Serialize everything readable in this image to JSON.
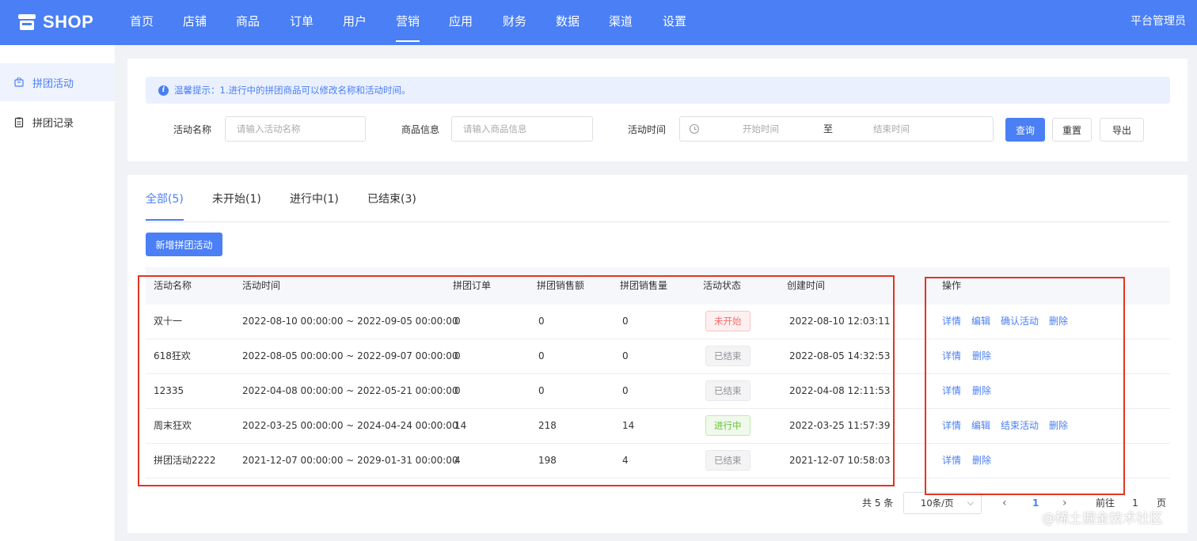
{
  "brand": {
    "logo_text": "SHOP",
    "icon": "shop-store-icon"
  },
  "nav": {
    "items": [
      "首页",
      "店铺",
      "商品",
      "订单",
      "用户",
      "营销",
      "应用",
      "财务",
      "数据",
      "渠道",
      "设置"
    ],
    "active": "营销",
    "admin": "平台管理员"
  },
  "sidebar": {
    "items": [
      {
        "label": "拼团活动",
        "icon": "bag-icon",
        "active": true
      },
      {
        "label": "拼团记录",
        "icon": "clipboard-icon",
        "active": false
      }
    ]
  },
  "filter": {
    "tip": "温馨提示：1.进行中的拼团商品可以修改名称和活动时间。",
    "name_label": "活动名称",
    "name_placeholder": "请输入活动名称",
    "goods_label": "商品信息",
    "goods_placeholder": "请输入商品信息",
    "time_label": "活动时间",
    "start_placeholder": "开始时间",
    "range_sep": "至",
    "end_placeholder": "结束时间",
    "query": "查询",
    "reset": "重置",
    "export": "导出"
  },
  "tabs": [
    "全部(5)",
    "未开始(1)",
    "进行中(1)",
    "已结束(3)"
  ],
  "add_button": "新增拼团活动",
  "table": {
    "headers": [
      "活动名称",
      "活动时间",
      "拼团订单",
      "拼团销售额",
      "拼团销售量",
      "活动状态",
      "创建时间",
      "操作"
    ],
    "rows": [
      {
        "name": "双十一",
        "time": "2022-08-10 00:00:00 ~ 2022-09-05 00:00:00",
        "orders": "0",
        "sales": "0",
        "quantity": "0",
        "status": "未开始",
        "status_type": "pending",
        "created": "2022-08-10 12:03:11",
        "actions": [
          "详情",
          "编辑",
          "确认活动",
          "删除"
        ]
      },
      {
        "name": "618狂欢",
        "time": "2022-08-05 00:00:00 ~ 2022-09-07 00:00:00",
        "orders": "0",
        "sales": "0",
        "quantity": "0",
        "status": "已结束",
        "status_type": "ended",
        "created": "2022-08-05 14:32:53",
        "actions": [
          "详情",
          "删除"
        ]
      },
      {
        "name": "12335",
        "time": "2022-04-08 00:00:00 ~ 2022-05-21 00:00:00",
        "orders": "0",
        "sales": "0",
        "quantity": "0",
        "status": "已结束",
        "status_type": "ended",
        "created": "2022-04-08 12:11:53",
        "actions": [
          "详情",
          "删除"
        ]
      },
      {
        "name": "周末狂欢",
        "time": "2022-03-25 00:00:00 ~ 2024-04-24 00:00:00",
        "orders": "14",
        "sales": "218",
        "quantity": "14",
        "status": "进行中",
        "status_type": "running",
        "created": "2022-03-25 11:57:39",
        "actions": [
          "详情",
          "编辑",
          "结束活动",
          "删除"
        ]
      },
      {
        "name": "拼团活动2222",
        "time": "2021-12-07 00:00:00 ~ 2029-01-31 00:00:00",
        "orders": "4",
        "sales": "198",
        "quantity": "4",
        "status": "已结束",
        "status_type": "ended",
        "created": "2021-12-07 10:58:03",
        "actions": [
          "详情",
          "删除"
        ]
      }
    ]
  },
  "pagination": {
    "total": "共 5 条",
    "page_size": "10条/页",
    "prev": "‹",
    "current": "1",
    "next": "›",
    "goto_label": "前往",
    "goto_value": "1",
    "page_unit": "页"
  },
  "watermark": "@稀土掘金技术社区",
  "colors": {
    "primary": "#4a7ff5",
    "highlight": "#e53420",
    "pending": "#f56c6c",
    "running": "#67c23a",
    "ended": "#909399"
  }
}
